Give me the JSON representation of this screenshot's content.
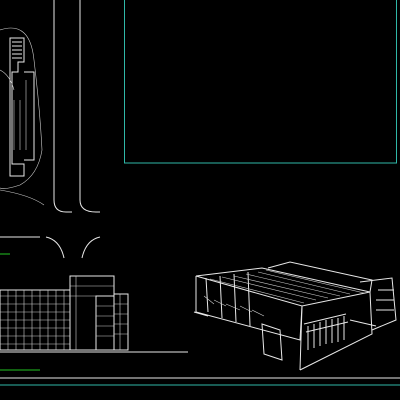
{
  "app": {
    "background": "#000000",
    "line_color": "#e8e8e8",
    "frame_color": "#2fb7a8",
    "marker_color": "#22c422"
  },
  "drawing": {
    "items": [
      "site-plan",
      "roads",
      "layout-viewport-frame",
      "building-elevation",
      "building-axonometric",
      "sheet-border"
    ]
  }
}
